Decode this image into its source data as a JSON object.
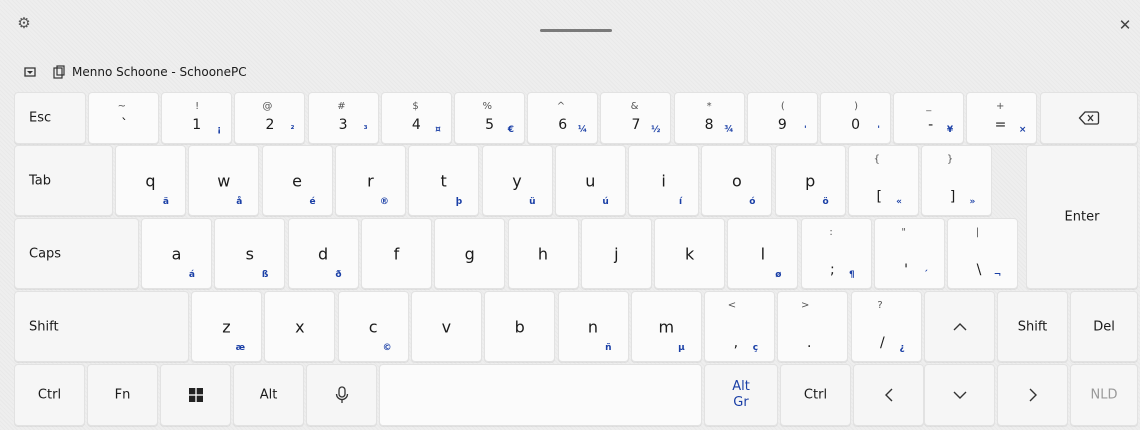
{
  "device": {
    "name": "Menno Schoone - SchoonePC"
  },
  "keys": {
    "esc": "Esc",
    "tab": "Tab",
    "caps": "Caps",
    "shift": "Shift",
    "shift_r": "Shift",
    "del": "Del",
    "enter": "Enter",
    "ctrl": "Ctrl",
    "fn": "Fn",
    "alt": "Alt",
    "altgr_1": "Alt",
    "altgr_2": "Gr",
    "ctrl_r": "Ctrl",
    "lang": "NLD",
    "up": "^",
    "down": "⌄",
    "left": "<",
    "right": ">"
  },
  "num_row": [
    {
      "pri": "`",
      "sh": "~",
      "alt": ""
    },
    {
      "pri": "1",
      "sh": "!",
      "alt": "¡"
    },
    {
      "pri": "2",
      "sh": "@",
      "alt": "²"
    },
    {
      "pri": "3",
      "sh": "#",
      "alt": "³"
    },
    {
      "pri": "4",
      "sh": "$",
      "alt": "¤"
    },
    {
      "pri": "5",
      "sh": "%",
      "alt": "€"
    },
    {
      "pri": "6",
      "sh": "^",
      "alt": "¼"
    },
    {
      "pri": "7",
      "sh": "&",
      "alt": "½"
    },
    {
      "pri": "8",
      "sh": "*",
      "alt": "¾"
    },
    {
      "pri": "9",
      "sh": "(",
      "alt": "'"
    },
    {
      "pri": "0",
      "sh": ")",
      "alt": "'"
    },
    {
      "pri": "-",
      "sh": "_",
      "alt": "¥"
    },
    {
      "pri": "=",
      "sh": "+",
      "alt": "×"
    }
  ],
  "row_q": [
    {
      "pri": "q",
      "sh": "",
      "alt": "ä"
    },
    {
      "pri": "w",
      "sh": "",
      "alt": "å"
    },
    {
      "pri": "e",
      "sh": "",
      "alt": "é"
    },
    {
      "pri": "r",
      "sh": "",
      "alt": "®"
    },
    {
      "pri": "t",
      "sh": "",
      "alt": "þ"
    },
    {
      "pri": "y",
      "sh": "",
      "alt": "ü"
    },
    {
      "pri": "u",
      "sh": "",
      "alt": "ú"
    },
    {
      "pri": "i",
      "sh": "",
      "alt": "í"
    },
    {
      "pri": "o",
      "sh": "",
      "alt": "ó"
    },
    {
      "pri": "p",
      "sh": "",
      "alt": "ö"
    },
    {
      "pri": "[",
      "sh": "{",
      "alt": "«"
    },
    {
      "pri": "]",
      "sh": "}",
      "alt": "»"
    }
  ],
  "row_a": [
    {
      "pri": "a",
      "sh": "",
      "alt": "á"
    },
    {
      "pri": "s",
      "sh": "",
      "alt": "ß"
    },
    {
      "pri": "d",
      "sh": "",
      "alt": "ð"
    },
    {
      "pri": "f",
      "sh": "",
      "alt": ""
    },
    {
      "pri": "g",
      "sh": "",
      "alt": ""
    },
    {
      "pri": "h",
      "sh": "",
      "alt": ""
    },
    {
      "pri": "j",
      "sh": "",
      "alt": ""
    },
    {
      "pri": "k",
      "sh": "",
      "alt": ""
    },
    {
      "pri": "l",
      "sh": "",
      "alt": "ø"
    },
    {
      "pri": ";",
      "sh": ":",
      "alt": "¶"
    },
    {
      "pri": "'",
      "sh": "\"",
      "alt": "´"
    },
    {
      "pri": "\\",
      "sh": "|",
      "alt": "¬"
    }
  ],
  "row_z": [
    {
      "pri": "z",
      "sh": "",
      "alt": "æ"
    },
    {
      "pri": "x",
      "sh": "",
      "alt": ""
    },
    {
      "pri": "c",
      "sh": "",
      "alt": "©"
    },
    {
      "pri": "v",
      "sh": "",
      "alt": ""
    },
    {
      "pri": "b",
      "sh": "",
      "alt": ""
    },
    {
      "pri": "n",
      "sh": "",
      "alt": "ñ"
    },
    {
      "pri": "m",
      "sh": "",
      "alt": "µ"
    },
    {
      "pri": ",",
      "sh": "<",
      "alt": "ç"
    },
    {
      "pri": ".",
      "sh": ">",
      "alt": ""
    },
    {
      "pri": "/",
      "sh": "?",
      "alt": "¿"
    }
  ],
  "icons": {
    "settings": "gear-icon",
    "close": "close-icon",
    "backspace": "backspace-icon",
    "windows": "windows-icon",
    "mic": "microphone-icon"
  },
  "colors": {
    "accent_alt": "#1a3fa6",
    "key_bg": "#fbfbfb",
    "bg": "#eeeeee"
  }
}
